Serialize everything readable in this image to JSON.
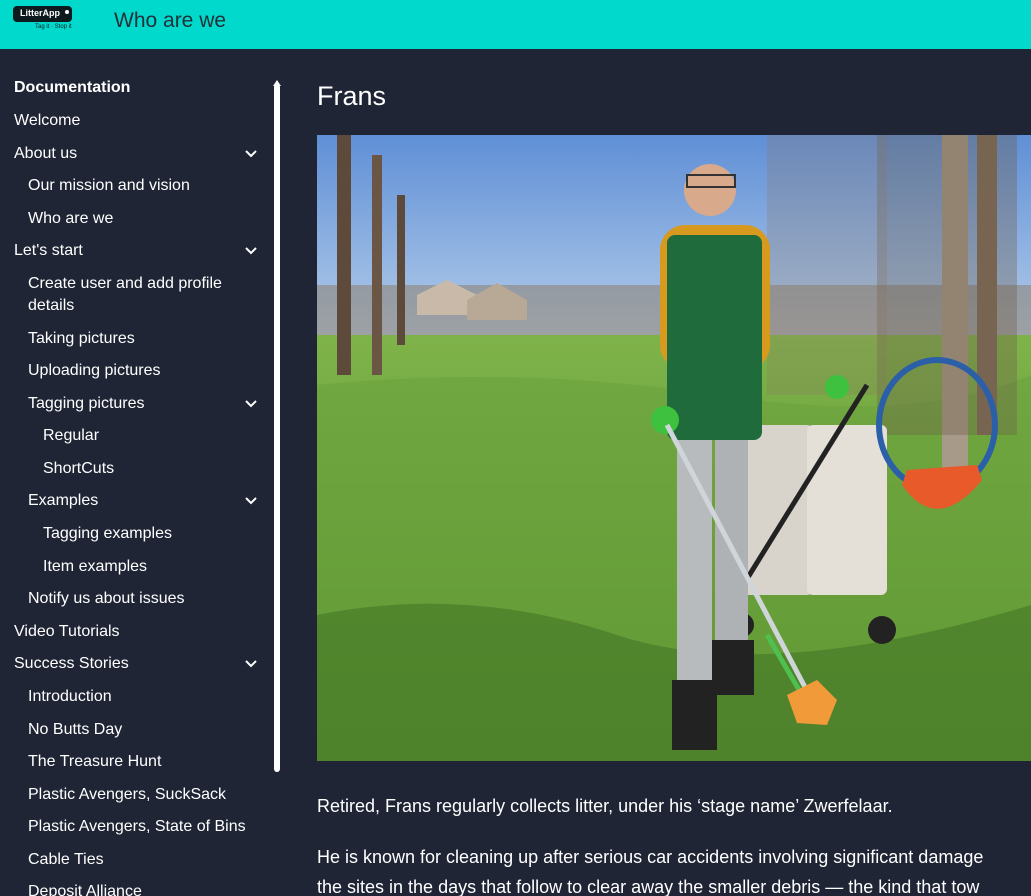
{
  "header": {
    "logo_text": "LitterApp",
    "logo_tagline": "Tag it · Stop it",
    "page_heading": "Who are we"
  },
  "sidebar": {
    "heading": "Documentation",
    "items": [
      {
        "label": "Welcome"
      },
      {
        "label": "About us"
      },
      {
        "label": "Our mission and vision"
      },
      {
        "label": "Who are we"
      },
      {
        "label": "Let's start"
      },
      {
        "label": "Create user and add profile"
      },
      {
        "label": "details"
      },
      {
        "label": "Taking pictures"
      },
      {
        "label": "Uploading pictures"
      },
      {
        "label": "Tagging pictures"
      },
      {
        "label": "Regular"
      },
      {
        "label": "ShortCuts"
      },
      {
        "label": "Examples"
      },
      {
        "label": "Tagging examples"
      },
      {
        "label": "Item examples"
      },
      {
        "label": "Notify us about issues"
      },
      {
        "label": "Video Tutorials"
      },
      {
        "label": "Success Stories"
      },
      {
        "label": "Introduction"
      },
      {
        "label": "No Butts Day"
      },
      {
        "label": "The Treasure Hunt"
      },
      {
        "label": "Plastic Avengers, SuckSack"
      },
      {
        "label": "Plastic Avengers, State of Bins"
      },
      {
        "label": "Cable Ties"
      },
      {
        "label": "Deposit Alliance"
      }
    ]
  },
  "main": {
    "title": "Frans",
    "paragraphs": [
      "Retired, Frans regularly collects litter, under his ‘stage name’ Zwerfelaar.",
      "He is known for cleaning up after serious car accidents involving significant damage",
      "the sites in the days that follow to clear away the smaller debris — the kind that tow"
    ]
  },
  "colors": {
    "header_bg": "#00d9cb",
    "page_bg": "#1f2535",
    "text": "#ffffff"
  },
  "icons": [
    "chevron-down-icon",
    "scroll-up-arrow-icon"
  ]
}
